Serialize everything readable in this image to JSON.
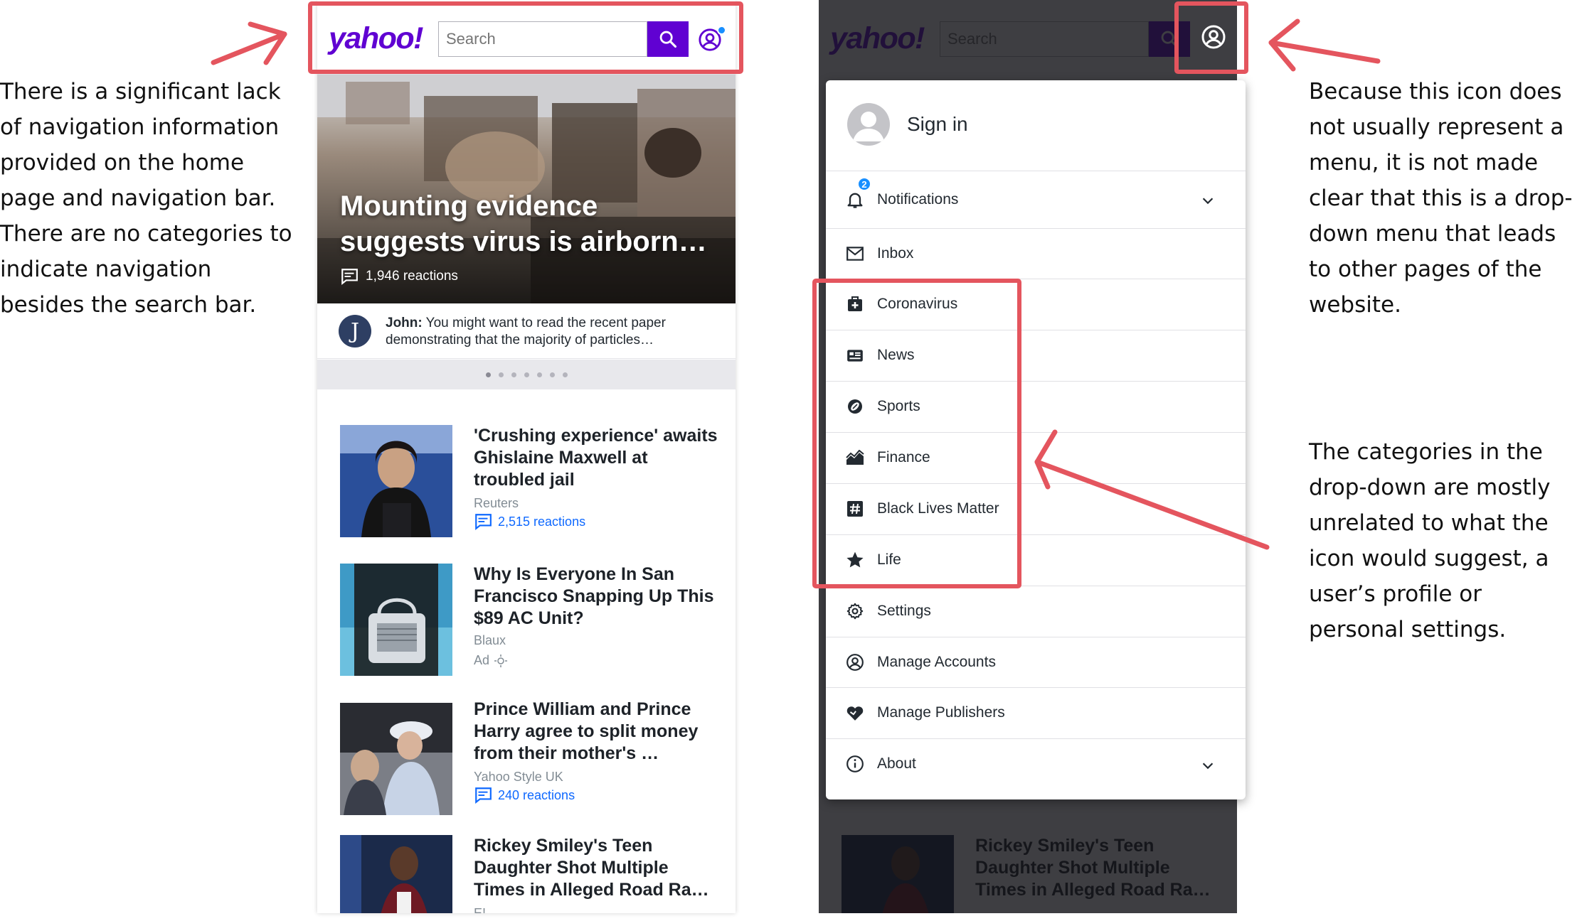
{
  "annotations": {
    "left": "There is a significant lack of navigation information provided on the home page and navigation bar. There are no categories to indicate navigation besides the search bar.",
    "right_top": "Because this icon does not usually represent a menu, it is not made clear that this is a drop-down menu that leads to other pages of the website.",
    "right_mid": "The categories in the drop-down are mostly unrelated to what the icon would suggest, a user’s profile or personal settings."
  },
  "header": {
    "logo": "yahoo!",
    "search_placeholder": "Search"
  },
  "hero": {
    "headline": "Mounting evidence suggests virus is airborn…",
    "reactions": "1,946 reactions"
  },
  "comment": {
    "initial": "J",
    "author": "John:",
    "text": "You might want to read the recent paper demonstrating that the majority of particles…"
  },
  "articles": [
    {
      "title": "'Crushing experience' awaits Ghislaine Maxwell at troubled jail",
      "source": "Reuters",
      "reactions": "2,515 reactions"
    },
    {
      "title": "Why Is Everyone In San Francisco Snapping Up This $89 AC Unit?",
      "source": "Blaux",
      "ad": "Ad"
    },
    {
      "title": "Prince William and Prince Harry agree to split money from their mother's …",
      "source": "Yahoo Style UK",
      "reactions": "240 reactions"
    },
    {
      "title": "Rickey Smiley's Teen Daughter Shot Multiple Times in Alleged Road Ra…",
      "source": "E!"
    }
  ],
  "menu": {
    "signin": "Sign in",
    "notification_count": "2",
    "items": [
      {
        "label": "Notifications",
        "icon": "bell-icon"
      },
      {
        "label": "Inbox",
        "icon": "mail-icon"
      },
      {
        "label": "Coronavirus",
        "icon": "medical-kit-icon"
      },
      {
        "label": "News",
        "icon": "newspaper-icon"
      },
      {
        "label": "Sports",
        "icon": "football-icon"
      },
      {
        "label": "Finance",
        "icon": "chart-area-icon"
      },
      {
        "label": "Black Lives Matter",
        "icon": "hashtag-icon"
      },
      {
        "label": "Life",
        "icon": "star-icon"
      },
      {
        "label": "Settings",
        "icon": "gear-icon"
      },
      {
        "label": "Manage Accounts",
        "icon": "user-circle-icon"
      },
      {
        "label": "Manage Publishers",
        "icon": "heart-icon"
      },
      {
        "label": "About",
        "icon": "info-icon"
      }
    ]
  },
  "colors": {
    "brand": "#6001d2",
    "highlight": "#e4555e",
    "link": "#0f69ff"
  }
}
